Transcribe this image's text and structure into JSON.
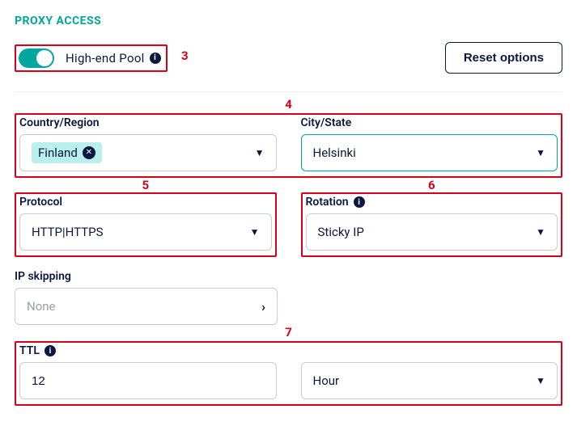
{
  "section_title": "PROXY ACCESS",
  "annotations": {
    "a3": "3",
    "a4": "4",
    "a5": "5",
    "a6": "6",
    "a7": "7"
  },
  "toggle": {
    "label": "High-end Pool",
    "on": true
  },
  "reset_label": "Reset options",
  "country": {
    "label": "Country/Region",
    "value": "Finland"
  },
  "city": {
    "label": "City/State",
    "value": "Helsinki"
  },
  "protocol": {
    "label": "Protocol",
    "value": "HTTP|HTTPS"
  },
  "rotation": {
    "label": "Rotation",
    "value": "Sticky IP"
  },
  "ipskipping": {
    "label": "IP skipping",
    "value": "None"
  },
  "ttl": {
    "label": "TTL",
    "value": "12",
    "unit": "Hour"
  }
}
